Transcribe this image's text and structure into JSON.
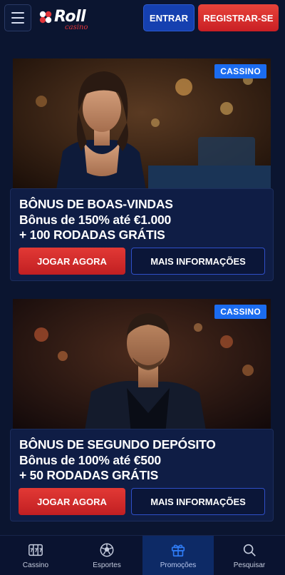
{
  "header": {
    "brand": "Roll",
    "brand_sub": "casino",
    "login_label": "ENTRAR",
    "register_label": "REGISTRAR-SE"
  },
  "promos": [
    {
      "tag": "CASSINO",
      "title": "BÔNUS DE BOAS-VINDAS",
      "line1": "Bônus de 150% até €1.000",
      "line2": "+ 100 RODADAS GRÁTIS",
      "play_label": "JOGAR AGORA",
      "info_label": "MAIS INFORMAÇÕES"
    },
    {
      "tag": "CASSINO",
      "title": "BÔNUS DE SEGUNDO DEPÓSITO",
      "line1": "Bônus de 100% até €500",
      "line2": "+ 50 RODADAS GRÁTIS",
      "play_label": "JOGAR AGORA",
      "info_label": "MAIS INFORMAÇÕES"
    }
  ],
  "bottom_nav": [
    {
      "label": "Cassino",
      "icon": "slot-machine-icon"
    },
    {
      "label": "Esportes",
      "icon": "soccer-ball-icon"
    },
    {
      "label": "Promoções",
      "icon": "gift-icon",
      "active": true
    },
    {
      "label": "Pesquisar",
      "icon": "search-icon"
    }
  ],
  "colors": {
    "background": "#0b1530",
    "primary_blue": "#1540b0",
    "accent_red": "#d62b2b",
    "tag_blue": "#1b6cf0",
    "nav_active": "#0d2a66"
  }
}
